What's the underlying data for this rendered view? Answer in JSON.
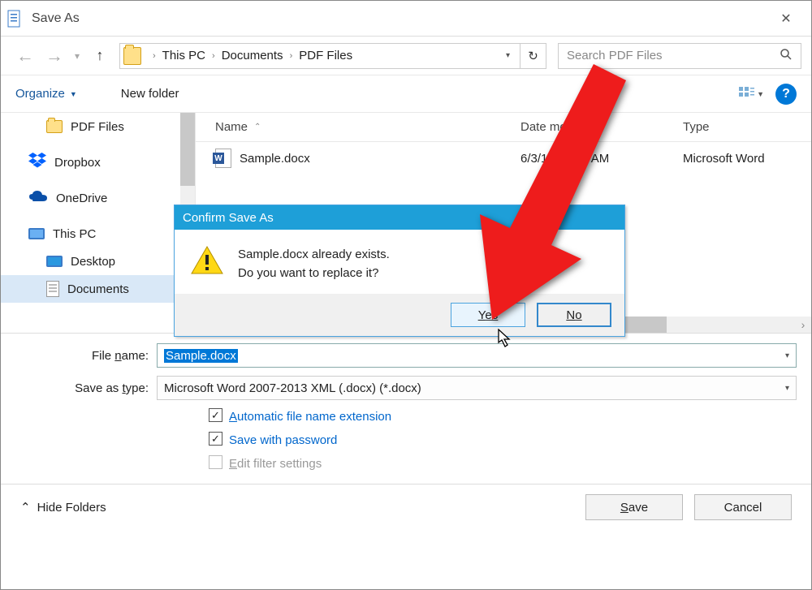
{
  "window": {
    "title": "Save As"
  },
  "breadcrumb": {
    "root": "This PC",
    "mid": "Documents",
    "leaf": "PDF Files"
  },
  "search": {
    "placeholder": "Search PDF Files"
  },
  "toolbar": {
    "organize": "Organize",
    "new_folder": "New folder"
  },
  "columns": {
    "name": "Name",
    "date": "Date modified",
    "type": "Type"
  },
  "file_row": {
    "name": "Sample.docx",
    "date": "6/3/16 12:28 AM",
    "type": "Microsoft Word"
  },
  "sidebar": {
    "pdf": "PDF Files",
    "dropbox": "Dropbox",
    "onedrive": "OneDrive",
    "thispc": "This PC",
    "desktop": "Desktop",
    "documents": "Documents"
  },
  "form": {
    "filename_label_pre": "File ",
    "filename_label_ul": "n",
    "filename_label_post": "ame:",
    "filename_value": "Sample.docx",
    "savetype_label_pre": "Save as ",
    "savetype_label_ul": "t",
    "savetype_label_post": "ype:",
    "savetype_value": "Microsoft Word 2007-2013 XML (.docx) (*.docx)",
    "chk_auto_pre": "A",
    "chk_auto_post": "utomatic file name extension",
    "chk_pw": "Save with password",
    "chk_filter_pre": "E",
    "chk_filter_post": "dit filter settings"
  },
  "footer": {
    "hide": "Hide Folders",
    "save_pre": "S",
    "save_post": "ave",
    "cancel": "Cancel"
  },
  "dialog": {
    "title": "Confirm Save As",
    "line1": "Sample.docx already exists.",
    "line2": "Do you want to replace it?",
    "yes_pre": "Y",
    "yes_post": "es",
    "no_pre": "N",
    "no_post": "o"
  }
}
